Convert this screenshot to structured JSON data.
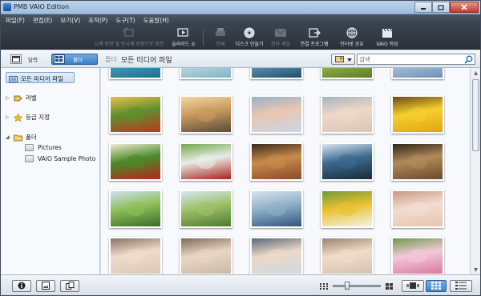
{
  "window": {
    "title": "PMB VAIO Edition",
    "controls": [
      "minimize-icon",
      "maximize-icon",
      "close-icon"
    ]
  },
  "menu": [
    "파일(F)",
    "편집(E)",
    "보기(V)",
    "조작(P)",
    "도구(T)",
    "도움말(H)"
  ],
  "toolbar": [
    {
      "label": "시계 방향 및 반시계 방향으로 회전",
      "icon": "rotate-icon",
      "enabled": false
    },
    {
      "label": "슬라이드 쇼",
      "icon": "slideshow-icon",
      "enabled": true
    },
    {
      "label": "인쇄",
      "icon": "print-icon",
      "enabled": false
    },
    {
      "label": "디스크 만들기",
      "icon": "disc-icon",
      "enabled": true
    },
    {
      "label": "전자 메일",
      "icon": "mail-icon",
      "enabled": false
    },
    {
      "label": "연결 프로그램",
      "icon": "open-with-icon",
      "enabled": true
    },
    {
      "label": "인터넷 공유",
      "icon": "globe-icon",
      "enabled": true
    },
    {
      "label": "VAIO 작성",
      "icon": "clapper-icon",
      "enabled": true
    }
  ],
  "viewbar": {
    "calendar_label": "달력",
    "folder_label": "폴더",
    "breadcrumb_root": "폴더",
    "breadcrumb_current": "모든 미디어 파일",
    "search_placeholder": "검색"
  },
  "sidebar": {
    "all_media": "모든 미디어 파일",
    "label": "라벨",
    "rating": "등급 지정",
    "folders": "폴더",
    "folder_items": [
      "Pictures",
      "VAIO Sample Photo"
    ]
  },
  "thumbnails": [
    {
      "subject": "ocean-coast",
      "colors": [
        "#1a6f8f",
        "#4fa3c4",
        "#a9d8e8"
      ]
    },
    {
      "subject": "beach-shore",
      "colors": [
        "#7fb4c8",
        "#c9dfe3",
        "#e8e4d4"
      ]
    },
    {
      "subject": "sea-horizon",
      "colors": [
        "#1e4f6d",
        "#6aa3c0",
        "#d9e6ea"
      ]
    },
    {
      "subject": "grass-field",
      "colors": [
        "#5a7a2a",
        "#9fbf4f",
        "#cfe29a"
      ]
    },
    {
      "subject": "sky-clouds",
      "colors": [
        "#6d8fb5",
        "#b7cce0",
        "#ecf1f6"
      ]
    },
    {
      "subject": "market-fruit",
      "colors": [
        "#b93a1e",
        "#5f8f2e",
        "#e8c04a"
      ]
    },
    {
      "subject": "sunset-sea",
      "colors": [
        "#5a4a3a",
        "#c99a5c",
        "#f1d8a3"
      ]
    },
    {
      "subject": "baby-lying",
      "colors": [
        "#c9d6e6",
        "#e9c6b2",
        "#9bb0c9"
      ]
    },
    {
      "subject": "baby-crawling",
      "colors": [
        "#d7c6b7",
        "#eed8c8",
        "#a7b3c0"
      ]
    },
    {
      "subject": "sunflowers",
      "colors": [
        "#e0a514",
        "#f5cf2e",
        "#6a4a14"
      ]
    },
    {
      "subject": "strawberries-price-tags",
      "colors": [
        "#b5271c",
        "#4a8a2a",
        "#f0e8d0"
      ]
    },
    {
      "subject": "strawberry-stall",
      "colors": [
        "#a6241b",
        "#e9ece8",
        "#6fa84a"
      ]
    },
    {
      "subject": "old-town-street",
      "colors": [
        "#8a4a2a",
        "#c98a4a",
        "#3a2a1e"
      ]
    },
    {
      "subject": "street-sign-night",
      "colors": [
        "#1a2a3a",
        "#3d6a8f",
        "#d8e4ef"
      ]
    },
    {
      "subject": "alley-bicycle",
      "colors": [
        "#6a4a2a",
        "#b08a5a",
        "#2e2418"
      ]
    },
    {
      "subject": "meadow-trees",
      "colors": [
        "#3b6d2a",
        "#8fc05a",
        "#cde0ef"
      ]
    },
    {
      "subject": "countryside-field",
      "colors": [
        "#4f7a2f",
        "#9ec26a",
        "#d7e6ef"
      ]
    },
    {
      "subject": "lake-town",
      "colors": [
        "#35557a",
        "#8fb0c9",
        "#d8e3ea"
      ]
    },
    {
      "subject": "daisy-flower",
      "colors": [
        "#f4f2e6",
        "#e9c130",
        "#6f9a3a"
      ]
    },
    {
      "subject": "sleeping-baby",
      "colors": [
        "#e7c3b0",
        "#f3dcd0",
        "#c99a86"
      ]
    },
    {
      "subject": "laughing-baby",
      "colors": [
        "#d9c7b6",
        "#efdccc",
        "#8a7464"
      ]
    },
    {
      "subject": "baby-smiling",
      "colors": [
        "#c9b9a9",
        "#ead6c4",
        "#7d6a5a"
      ]
    },
    {
      "subject": "toddler-portrait",
      "colors": [
        "#cfd8e2",
        "#ecd8c6",
        "#5a6a7a"
      ]
    },
    {
      "subject": "baby-face",
      "colors": [
        "#d4c2b2",
        "#f0dcc8",
        "#9a8474"
      ]
    },
    {
      "subject": "pink-bouquet",
      "colors": [
        "#d97aa0",
        "#f3c9d8",
        "#6f9a4a"
      ]
    }
  ],
  "statusbar": {
    "buttons": [
      "info-icon",
      "image-frame-icon",
      "copy-icon"
    ],
    "zoom_level": 0.3,
    "view_buttons": [
      "large-grid-icon",
      "filmstrip-icon",
      "thumbnail-view-icon",
      "details-view-icon"
    ]
  }
}
